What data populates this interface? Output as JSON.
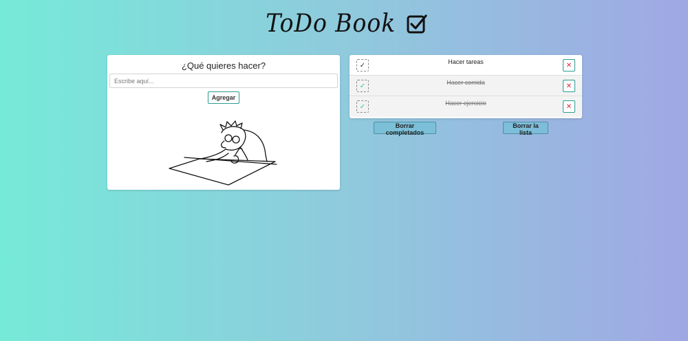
{
  "app": {
    "title": "ToDo Book",
    "title_icon": "checkbox-checked-icon"
  },
  "form": {
    "question": "¿Qué quieres hacer?",
    "input_value": "",
    "input_placeholder": "Escribe aquí...",
    "add_label": "Agregar",
    "illustration": "person-writing-illustration"
  },
  "tasks": [
    {
      "text": "Hacer tareas",
      "completed": false
    },
    {
      "text": "Hacer comida",
      "completed": true
    },
    {
      "text": "Hacer ejercicio",
      "completed": true
    }
  ],
  "icons": {
    "check": "✓",
    "delete": "✕"
  },
  "actions": {
    "clear_completed_label": "Borrar completados",
    "clear_list_label": "Borrar la lista"
  },
  "colors": {
    "gradient_start": "#76ead9",
    "gradient_end": "#a0a8e4",
    "accent": "#2a9d8f",
    "delete": "#d9263f",
    "check_done": "#2ec4a0"
  }
}
